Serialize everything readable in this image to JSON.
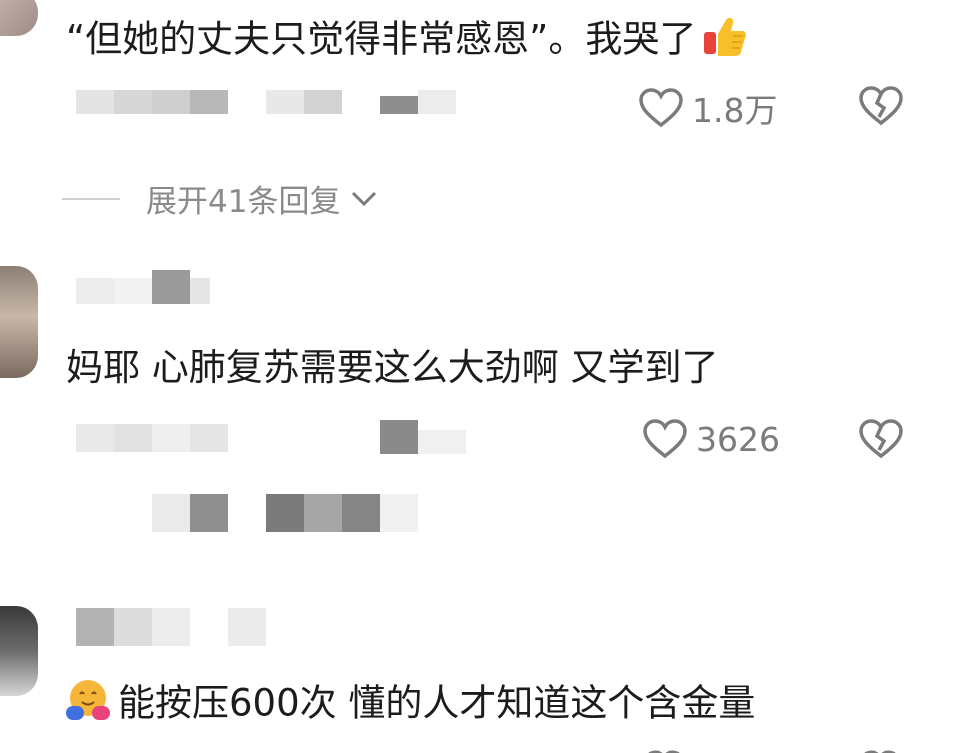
{
  "comments": [
    {
      "text": "“但她的丈夫只觉得非常感恩”。我哭了",
      "emoji": "thumbs-up-emoji",
      "likes": "1.8万"
    },
    {
      "text": "妈耶 心肺复苏需要这么大劲啊 又学到了",
      "likes": "3626"
    },
    {
      "text": "能按压600次 懂的人才知道这个含金量",
      "emoji": "hugging-face-emoji"
    }
  ],
  "expand_replies": "展开41条回复",
  "icons": {
    "like": "heart-outline-icon",
    "dislike": "broken-heart-icon",
    "expand": "chevron-down-icon"
  },
  "colors": {
    "text": "#1c1c1c",
    "meta": "#7b7b7b",
    "expand": "#8a8a8a"
  }
}
